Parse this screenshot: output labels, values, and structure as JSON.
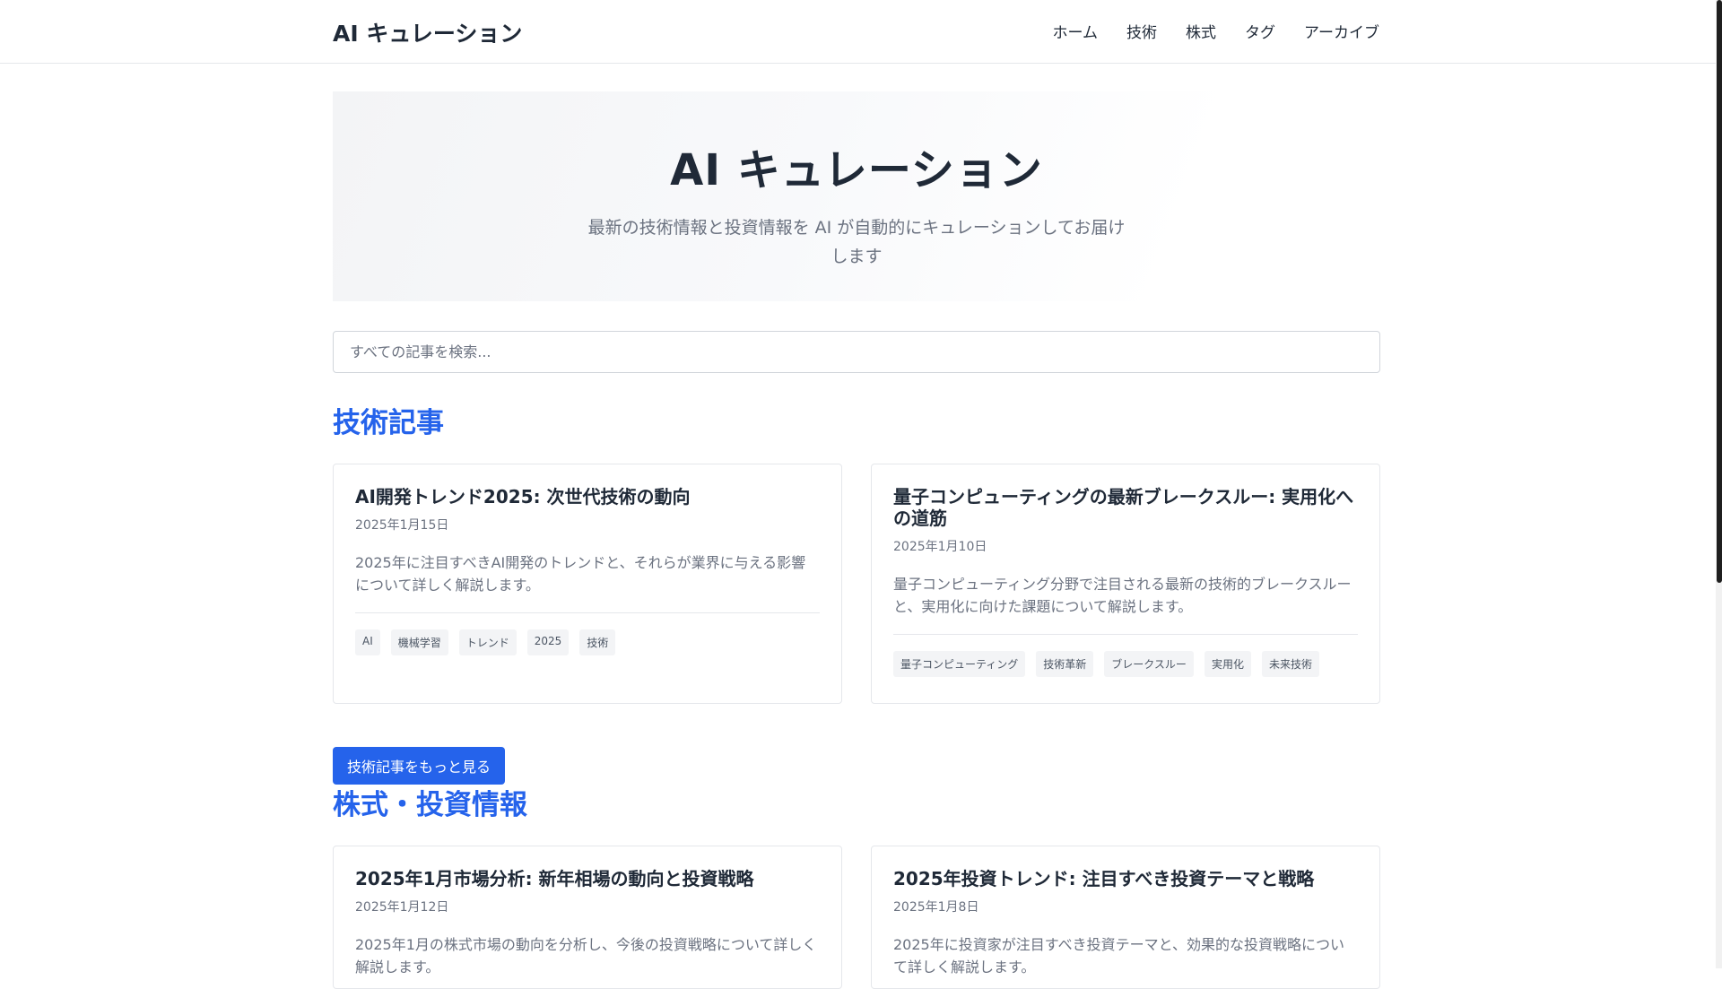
{
  "header": {
    "logo": "AI キュレーション",
    "nav": [
      "ホーム",
      "技術",
      "株式",
      "タグ",
      "アーカイブ"
    ]
  },
  "hero": {
    "title": "AI キュレーション",
    "subtitle": "最新の技術情報と投資情報を AI が自動的にキュレーションしてお届けします"
  },
  "search": {
    "placeholder": "すべての記事を検索..."
  },
  "tech": {
    "title": "技術記事",
    "more_label": "技術記事をもっと見る",
    "cards": [
      {
        "title": "AI開発トレンド2025: 次世代技術の動向",
        "date": "2025年1月15日",
        "excerpt": "2025年に注目すべきAI開発のトレンドと、それらが業界に与える影響について詳しく解説します。",
        "tags": [
          "AI",
          "機械学習",
          "トレンド",
          "2025",
          "技術"
        ]
      },
      {
        "title": "量子コンピューティングの最新ブレークスルー: 実用化への道筋",
        "date": "2025年1月10日",
        "excerpt": "量子コンピューティング分野で注目される最新の技術的ブレークスルーと、実用化に向けた課題について解説します。",
        "tags": [
          "量子コンピューティング",
          "技術革新",
          "ブレークスルー",
          "実用化",
          "未来技術"
        ]
      }
    ]
  },
  "stocks": {
    "title": "株式・投資情報",
    "cards": [
      {
        "title": "2025年1月市場分析: 新年相場の動向と投資戦略",
        "date": "2025年1月12日",
        "excerpt": "2025年1月の株式市場の動向を分析し、今後の投資戦略について詳しく解説します。"
      },
      {
        "title": "2025年投資トレンド: 注目すべき投資テーマと戦略",
        "date": "2025年1月8日",
        "excerpt": "2025年に投資家が注目すべき投資テーマと、効果的な投資戦略について詳しく解説します。"
      }
    ]
  }
}
